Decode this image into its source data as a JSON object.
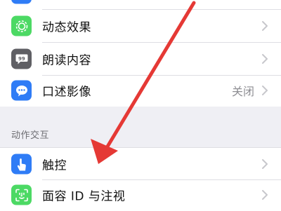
{
  "group1": {
    "items": [
      {
        "label": "",
        "icon": "accessibility-icon",
        "color": "#2f7cf6"
      },
      {
        "label": "动态效果",
        "icon": "motion-icon",
        "color": "#4cd964"
      },
      {
        "label": "朗读内容",
        "icon": "speech-icon",
        "color": "#5f5f64"
      },
      {
        "label": "口述影像",
        "icon": "audio-description-icon",
        "color": "#2f7cf6",
        "value": "关闭"
      }
    ]
  },
  "section": {
    "header": "动作交互"
  },
  "group2": {
    "items": [
      {
        "label": "触控",
        "icon": "touch-icon",
        "color": "#2f7cf6"
      },
      {
        "label": "面容 ID 与注视",
        "icon": "face-id-icon",
        "color": "#4cd964"
      }
    ]
  },
  "colors": {
    "arrow": "#e53935",
    "background": "#efeff4",
    "separator": "#dedee3",
    "chevron": "#c7c7cc"
  }
}
